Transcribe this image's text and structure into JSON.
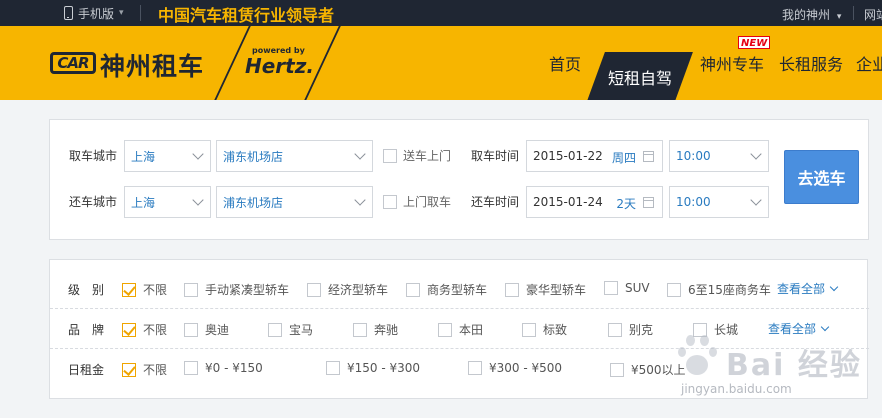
{
  "topbar": {
    "mobile_label": "手机版",
    "slogan": "中国汽车租赁行业领导者",
    "my_account": "我的神州",
    "site_link": "网站"
  },
  "brand": {
    "logo_car": "CAR",
    "logo_name": "神州租车",
    "powered_by": "powered by",
    "partner": "Hertz."
  },
  "nav": {
    "items": [
      "首页",
      "短租自驾",
      "神州专车",
      "长租服务",
      "企业"
    ],
    "active": "短租自驾",
    "badge": "NEW"
  },
  "search": {
    "pickup_city_label": "取车城市",
    "return_city_label": "还车城市",
    "pickup_city": "上海",
    "return_city": "上海",
    "pickup_store": "浦东机场店",
    "return_store": "浦东机场店",
    "delivery_label": "送车上门",
    "collect_label": "上门取车",
    "pickup_time_label": "取车时间",
    "return_time_label": "还车时间",
    "pickup_date": "2015-01-22",
    "pickup_day": "周四",
    "return_date": "2015-01-24",
    "return_days": "2天",
    "pickup_clock": "10:00",
    "return_clock": "10:00",
    "submit": "去选车"
  },
  "filters": {
    "view_all": "查看全部",
    "level": {
      "title": "级　别",
      "options": [
        "不限",
        "手动紧凑型轿车",
        "经济型轿车",
        "商务型轿车",
        "豪华型轿车",
        "SUV",
        "6至15座商务车"
      ]
    },
    "brand": {
      "title": "品　牌",
      "options": [
        "不限",
        "奥迪",
        "宝马",
        "奔驰",
        "本田",
        "标致",
        "别克",
        "长城"
      ]
    },
    "price": {
      "title": "日租金",
      "options": [
        "不限",
        "¥0 - ¥150",
        "¥150 - ¥300",
        "¥300 - ¥500",
        "¥500以上"
      ]
    }
  },
  "watermark": {
    "text": "Bai 经验",
    "url": "jingyan.baidu.com"
  },
  "colors": {
    "brand_yellow": "#f7b500",
    "dark": "#1f2633",
    "link_blue": "#2a7bc0",
    "button_blue": "#4a8fdf"
  }
}
